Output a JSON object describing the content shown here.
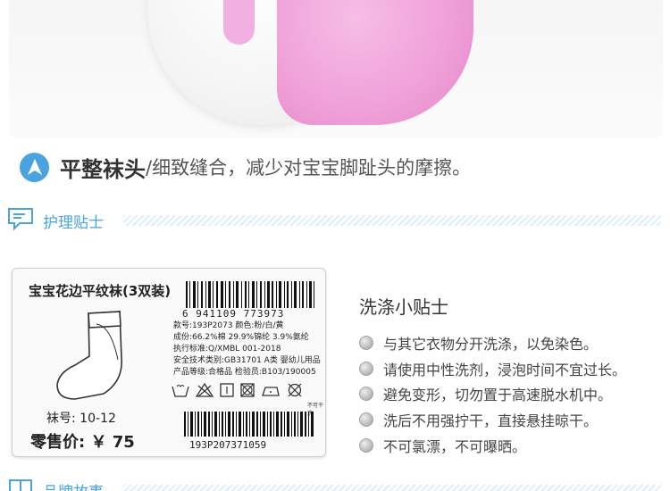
{
  "feature": {
    "title": "平整袜头",
    "description": "/细致缝合，减少对宝宝脚趾头的摩擦。"
  },
  "sections": {
    "care": "护理贴士",
    "brand": "品牌故事"
  },
  "label_card": {
    "title": "宝宝花边平纹袜(3双装)",
    "ean": "6 941109 773973",
    "info_lines": [
      "款号:193P2073      颜色:粉/白/黄",
      "成份:66.2%棉 29.9%锦纶 3.9%氨纶",
      "执行标准:Q/XMBL 001-2018",
      "安全技术类别:GB31701 A类 婴幼儿用品",
      "产品等级:合格品  检验员:B103/190005"
    ],
    "care_note": "不可干洗",
    "size": "袜号: 10-12",
    "price": "零售价: ￥ 75",
    "code": "193P207371059"
  },
  "tips": {
    "title": "洗涤小贴士",
    "items": [
      "与其它衣物分开洗涤，以免染色。",
      "请使用中性洗剂，浸泡时间不宜过长。",
      "避免变形，切勿置于高速脱水机中。",
      "洗后不用强拧干，直接悬挂晾干。",
      "不可氯漂，不可曝晒。"
    ]
  },
  "colors": {
    "accent": "#4ba3de",
    "pink": "#ef9fd8"
  }
}
